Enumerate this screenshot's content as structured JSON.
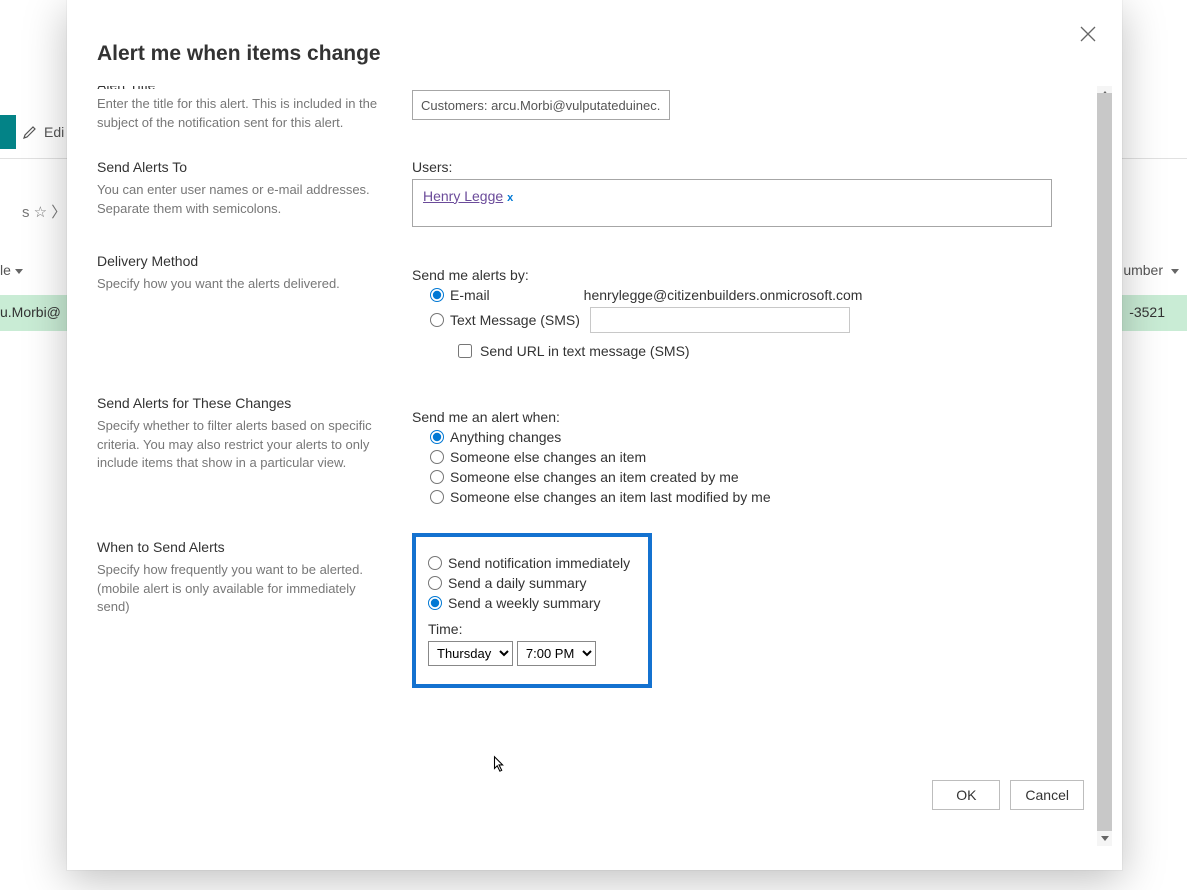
{
  "background": {
    "edit_label": "Edi",
    "star_breadcrumb": "s ☆ 〉",
    "col_left": "le",
    "col_right": "umber",
    "row_left": "u.Morbi@",
    "row_right": "-3521"
  },
  "dialog": {
    "title": "Alert me when items change",
    "footer": {
      "ok": "OK",
      "cancel": "Cancel"
    }
  },
  "sections": {
    "alert_title": {
      "heading": "Alert Title",
      "desc": "Enter the title for this alert. This is included in the subject of the notification sent for this alert.",
      "value": "Customers: arcu.Morbi@vulputateduinec."
    },
    "send_to": {
      "heading": "Send Alerts To",
      "desc": "You can enter user names or e-mail addresses. Separate them with semicolons.",
      "field_label": "Users:",
      "user_name": "Henry Legge",
      "remove_glyph": "x"
    },
    "delivery": {
      "heading": "Delivery Method",
      "desc": "Specify how you want the alerts delivered.",
      "legend": "Send me alerts by:",
      "email_label": "E-mail",
      "email_value": "henrylegge@citizenbuilders.onmicrosoft.com",
      "sms_label": "Text Message (SMS)",
      "sms_url_label": "Send URL in text message (SMS)"
    },
    "changes": {
      "heading": "Send Alerts for These Changes",
      "desc": "Specify whether to filter alerts based on specific criteria. You may also restrict your alerts to only include items that show in a particular view.",
      "legend": "Send me an alert when:",
      "opts": [
        "Anything changes",
        "Someone else changes an item",
        "Someone else changes an item created by me",
        "Someone else changes an item last modified by me"
      ]
    },
    "when": {
      "heading": "When to Send Alerts",
      "desc": "Specify how frequently you want to be alerted. (mobile alert is only available for immediately send)",
      "opts": [
        "Send notification immediately",
        "Send a daily summary",
        "Send a weekly summary"
      ],
      "time_label": "Time:",
      "day": "Thursday",
      "hour": "7:00 PM"
    }
  }
}
